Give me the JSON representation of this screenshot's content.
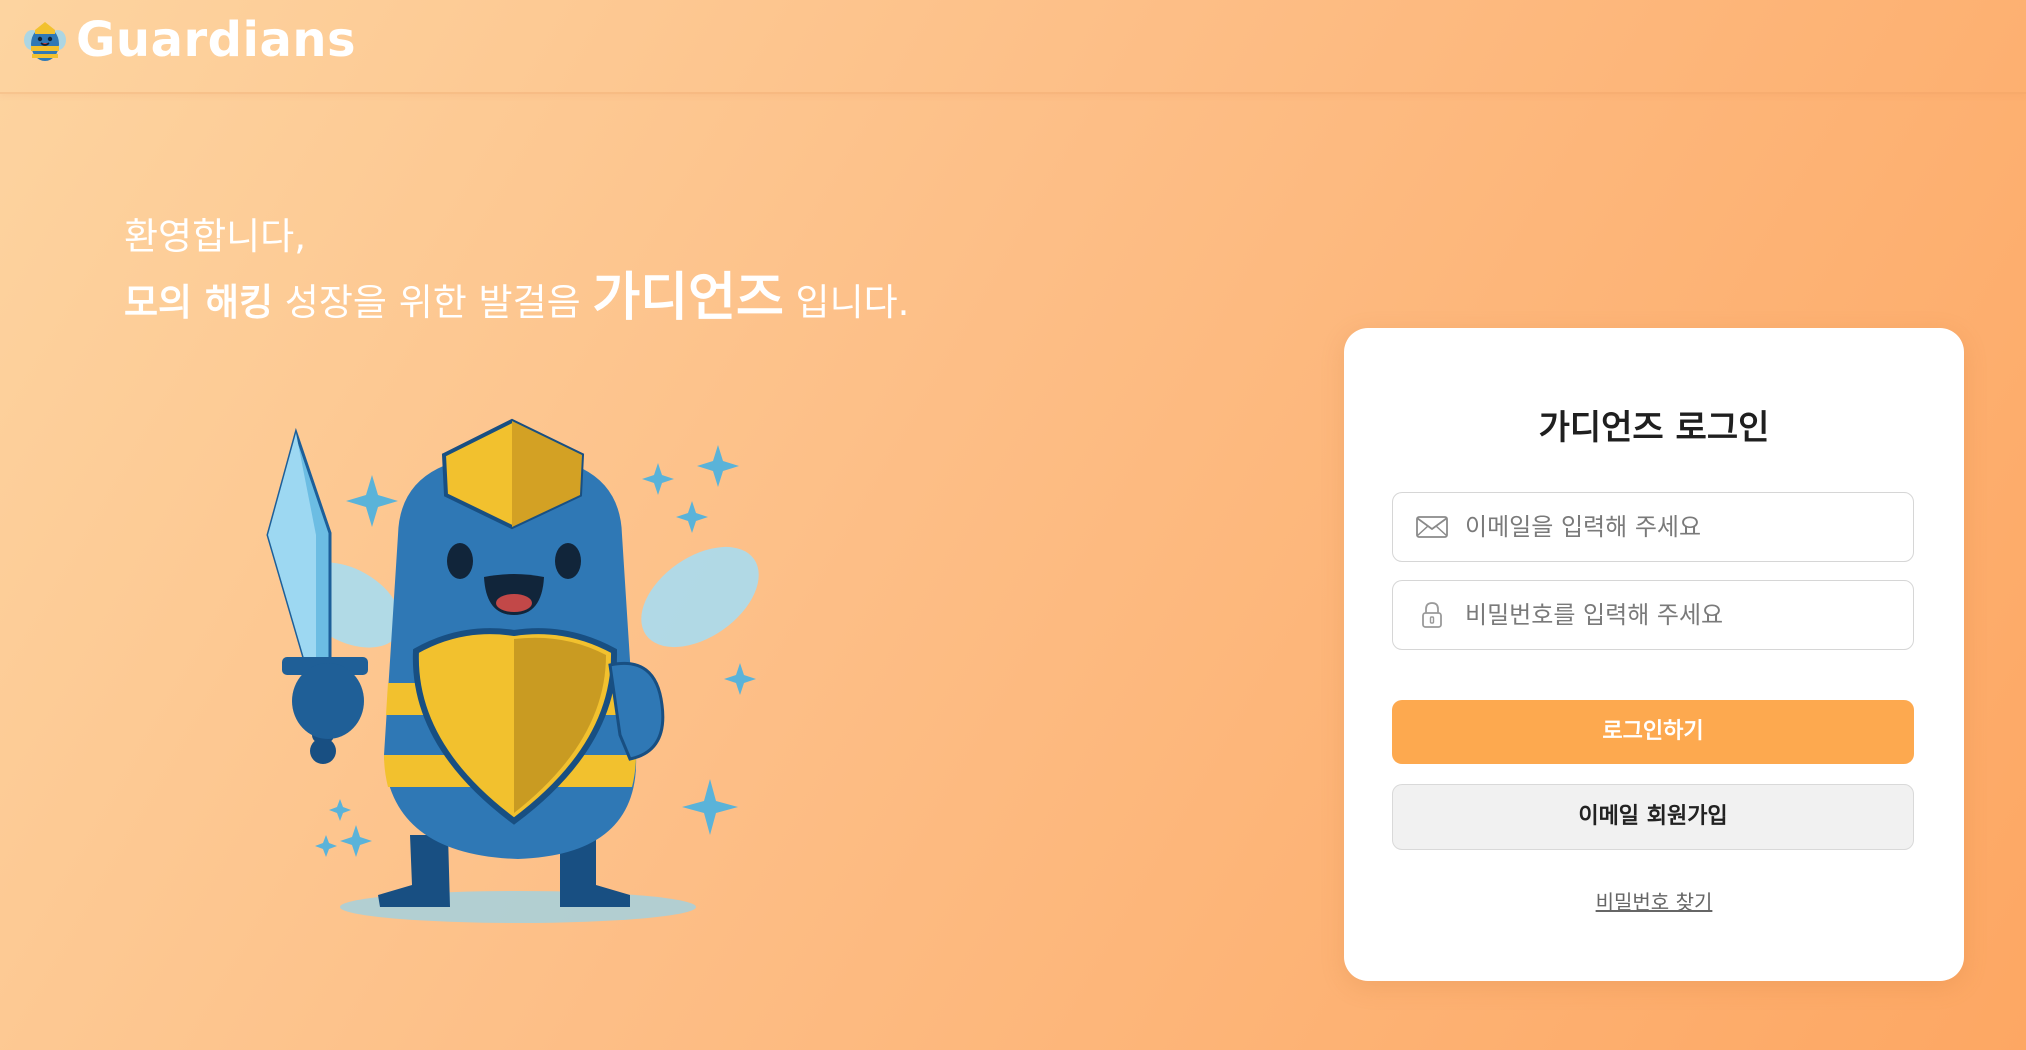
{
  "header": {
    "brand_name": "Guardians",
    "logo_icon": "bee-mascot-logo"
  },
  "welcome": {
    "line1": "환영합니다,",
    "line2_part1": "모의 해킹",
    "line2_part2": " 성장을 위한 발걸음 ",
    "line2_part3": "가디언즈",
    "line2_part4": " 입니다."
  },
  "illustration": {
    "icon": "bee-knight-mascot"
  },
  "login_card": {
    "title": "가디언즈 로그인",
    "email": {
      "icon": "envelope-icon",
      "value": "",
      "placeholder": "이메일을 입력해 주세요"
    },
    "password": {
      "icon": "lock-icon",
      "value": "",
      "placeholder": "비밀번호를 입력해 주세요"
    },
    "login_button": "로그인하기",
    "signup_button": "이메일 회원가입",
    "find_password_link": "비밀번호 찾기"
  },
  "colors": {
    "accent": "#fda94f",
    "background_start": "#fdd4a0",
    "background_end": "#fda763"
  }
}
